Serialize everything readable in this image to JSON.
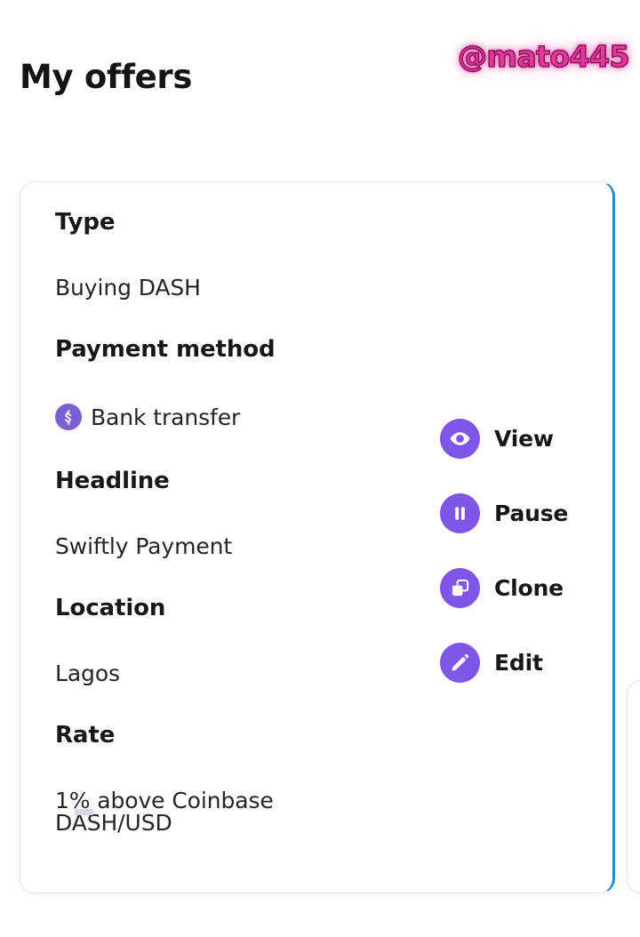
{
  "header": {
    "title": "My offers",
    "watermark": "@mato445",
    "watermark_color": "#e4389c"
  },
  "theme": {
    "card_accent_border": "#2288c8",
    "card_border": "#e6e6e8",
    "action_icon_bg": "#7f56e8",
    "payment_icon_bg": "#7b5fd6",
    "rate_mark_color": "#ddd3ef",
    "background": "#ffffff"
  },
  "offer_card": {
    "fields": [
      {
        "label": "Type",
        "value": "Buying DASH"
      },
      {
        "label": "Payment method",
        "value": "Bank transfer",
        "icon": "dollar-circle-icon"
      },
      {
        "label": "Headline",
        "value": "Swiftly Payment"
      },
      {
        "label": "Location",
        "value": "Lagos"
      },
      {
        "label": "Rate",
        "value": "1% above Coinbase DASH/USD"
      }
    ],
    "actions": [
      {
        "label": "View",
        "icon": "eye-icon"
      },
      {
        "label": "Pause",
        "icon": "pause-icon"
      },
      {
        "label": "Clone",
        "icon": "copy-icon"
      },
      {
        "label": "Edit",
        "icon": "pencil-icon"
      }
    ]
  }
}
